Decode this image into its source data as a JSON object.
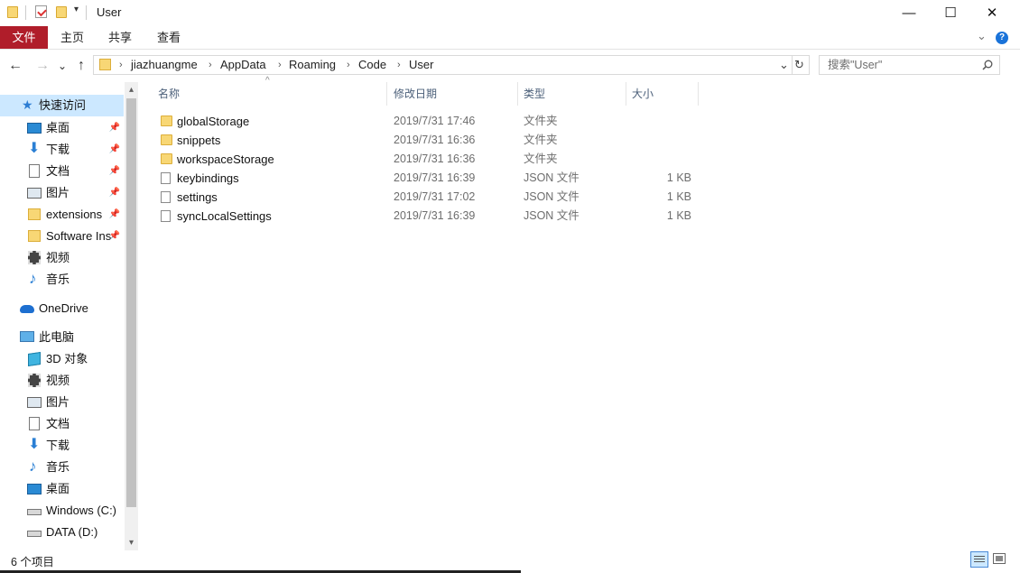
{
  "window": {
    "title": "User",
    "minimize_glyph": "—",
    "maximize_glyph": "☐",
    "close_glyph": "✕"
  },
  "ribbon": {
    "tabs": [
      {
        "label": "文件",
        "active": true
      },
      {
        "label": "主页"
      },
      {
        "label": "共享"
      },
      {
        "label": "查看"
      }
    ],
    "collapse_glyph": "⌄",
    "help_glyph": "?"
  },
  "nav": {
    "back_glyph": "←",
    "forward_glyph": "→",
    "recent_glyph": "⌄",
    "up_glyph": "↑"
  },
  "address": {
    "crumbs": [
      "jiazhuangme",
      "AppData",
      "Roaming",
      "Code",
      "User"
    ],
    "separator": "›",
    "dropdown_glyph": "⌄",
    "refresh_glyph": "↻"
  },
  "search": {
    "placeholder": "搜索\"User\"",
    "icon": "search-icon"
  },
  "sidebar": {
    "quick_access": {
      "label": "快速访问",
      "items": [
        {
          "label": "桌面",
          "icon": "desktop-icon",
          "pinned": true
        },
        {
          "label": "下载",
          "icon": "download-icon",
          "pinned": true
        },
        {
          "label": "文档",
          "icon": "documents-icon",
          "pinned": true
        },
        {
          "label": "图片",
          "icon": "pictures-icon",
          "pinned": true
        },
        {
          "label": "extensions",
          "icon": "folder-icon",
          "pinned": true
        },
        {
          "label": "Software Ins",
          "icon": "folder-icon",
          "pinned": true
        },
        {
          "label": "视频",
          "icon": "videos-icon",
          "pinned": false
        },
        {
          "label": "音乐",
          "icon": "music-icon",
          "pinned": false
        }
      ]
    },
    "onedrive": {
      "label": "OneDrive"
    },
    "this_pc": {
      "label": "此电脑",
      "items": [
        {
          "label": "3D 对象",
          "icon": "3d-objects-icon"
        },
        {
          "label": "视频",
          "icon": "videos-icon"
        },
        {
          "label": "图片",
          "icon": "pictures-icon"
        },
        {
          "label": "文档",
          "icon": "documents-icon"
        },
        {
          "label": "下载",
          "icon": "download-icon"
        },
        {
          "label": "音乐",
          "icon": "music-icon"
        },
        {
          "label": "桌面",
          "icon": "desktop-icon"
        },
        {
          "label": "Windows (C:)",
          "icon": "drive-icon"
        },
        {
          "label": "DATA (D:)",
          "icon": "drive-icon"
        }
      ]
    },
    "pin_glyph": "📌",
    "scroll_up_glyph": "▴",
    "scroll_down_glyph": "▾"
  },
  "file_list": {
    "columns": [
      "名称",
      "修改日期",
      "类型",
      "大小"
    ],
    "sort_glyph": "^",
    "rows": [
      {
        "name": "globalStorage",
        "date": "2019/7/31 17:46",
        "type": "文件夹",
        "size": "",
        "kind": "folder"
      },
      {
        "name": "snippets",
        "date": "2019/7/31 16:36",
        "type": "文件夹",
        "size": "",
        "kind": "folder"
      },
      {
        "name": "workspaceStorage",
        "date": "2019/7/31 16:36",
        "type": "文件夹",
        "size": "",
        "kind": "folder"
      },
      {
        "name": "keybindings",
        "date": "2019/7/31 16:39",
        "type": "JSON 文件",
        "size": "1 KB",
        "kind": "file"
      },
      {
        "name": "settings",
        "date": "2019/7/31 17:02",
        "type": "JSON 文件",
        "size": "1 KB",
        "kind": "file"
      },
      {
        "name": "syncLocalSettings",
        "date": "2019/7/31 16:39",
        "type": "JSON 文件",
        "size": "1 KB",
        "kind": "file"
      }
    ]
  },
  "status": {
    "item_count": "6 个项目"
  },
  "colors": {
    "file_tab": "#b01d2a",
    "folder": "#f8d775",
    "selected_nav": "#cce8ff",
    "help": "#1a73d9"
  }
}
